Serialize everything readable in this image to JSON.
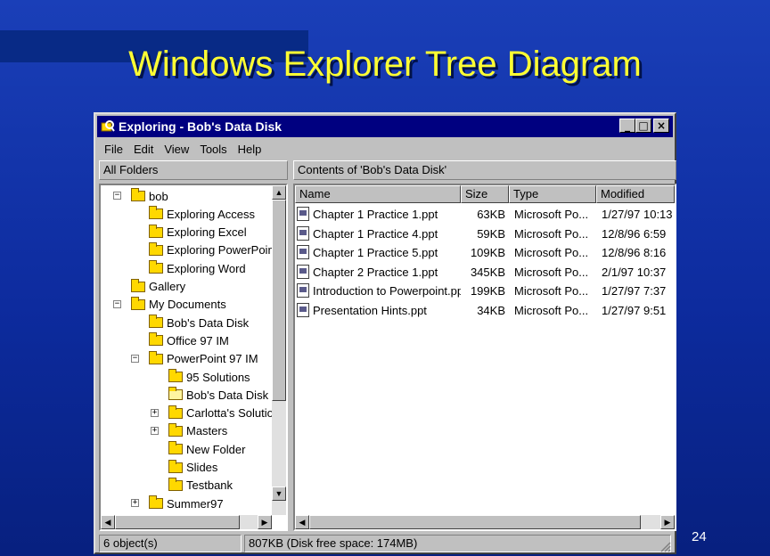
{
  "slide": {
    "title": "Windows Explorer Tree Diagram",
    "page_number": "24"
  },
  "window": {
    "title": "Exploring - Bob's Data Disk",
    "caption_minimize": "_",
    "caption_maximize": "□",
    "caption_close": "×"
  },
  "menu": [
    {
      "label": "File"
    },
    {
      "label": "Edit"
    },
    {
      "label": "View"
    },
    {
      "label": "Tools"
    },
    {
      "label": "Help"
    }
  ],
  "tree_header": "All Folders",
  "contents_header": "Contents of 'Bob's Data Disk'",
  "tree": [
    {
      "label": "bob",
      "level": 0,
      "expander": "−"
    },
    {
      "label": "Exploring Access",
      "level": 1
    },
    {
      "label": "Exploring Excel",
      "level": 1
    },
    {
      "label": "Exploring PowerPoint",
      "level": 1
    },
    {
      "label": "Exploring Word",
      "level": 1
    },
    {
      "label": "Gallery",
      "level": 0
    },
    {
      "label": "My Documents",
      "level": 0,
      "expander": "−"
    },
    {
      "label": "Bob's Data Disk",
      "level": 1
    },
    {
      "label": "Office 97 IM",
      "level": 1
    },
    {
      "label": "PowerPoint 97 IM",
      "level": 1,
      "expander": "−"
    },
    {
      "label": "95 Solutions",
      "level": 2
    },
    {
      "label": "Bob's Data Disk",
      "level": 2,
      "open": true
    },
    {
      "label": "Carlotta's Solution",
      "level": 2,
      "expander": "+"
    },
    {
      "label": "Masters",
      "level": 2,
      "expander": "+"
    },
    {
      "label": "New Folder",
      "level": 2
    },
    {
      "label": "Slides",
      "level": 2
    },
    {
      "label": "Testbank",
      "level": 2
    },
    {
      "label": "Summer97",
      "level": 1,
      "expander": "+"
    }
  ],
  "columns": [
    {
      "label": "Name"
    },
    {
      "label": "Size"
    },
    {
      "label": "Type"
    },
    {
      "label": "Modified"
    }
  ],
  "files": [
    {
      "name": "Chapter 1 Practice 1.ppt",
      "size": "63KB",
      "type": "Microsoft Po...",
      "modified": "1/27/97 10:13"
    },
    {
      "name": "Chapter 1 Practice 4.ppt",
      "size": "59KB",
      "type": "Microsoft Po...",
      "modified": "12/8/96 6:59"
    },
    {
      "name": "Chapter 1 Practice 5.ppt",
      "size": "109KB",
      "type": "Microsoft Po...",
      "modified": "12/8/96 8:16"
    },
    {
      "name": "Chapter 2 Practice 1.ppt",
      "size": "345KB",
      "type": "Microsoft Po...",
      "modified": "2/1/97 10:37"
    },
    {
      "name": "Introduction to Powerpoint.ppt",
      "size": "199KB",
      "type": "Microsoft Po...",
      "modified": "1/27/97 7:37"
    },
    {
      "name": "Presentation Hints.ppt",
      "size": "34KB",
      "type": "Microsoft Po...",
      "modified": "1/27/97 9:51"
    }
  ],
  "status": {
    "objects": "6 object(s)",
    "disk": "807KB (Disk free space: 174MB)"
  },
  "icons": {
    "app": "explorer-icon",
    "folder": "folder-icon",
    "file": "ppt-file-icon"
  },
  "colors": {
    "title_text": "#ffff33",
    "titlebar": "#000080",
    "background": "#1a3fb8"
  }
}
